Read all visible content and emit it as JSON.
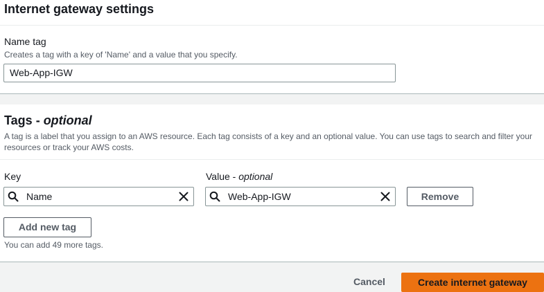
{
  "settings": {
    "title": "Internet gateway settings",
    "name_label": "Name tag",
    "name_desc": "Creates a tag with a key of 'Name' and a value that you specify.",
    "name_value": "Web-App-IGW"
  },
  "tags": {
    "title": "Tags",
    "title_suffix": "optional",
    "desc": "A tag is a label that you assign to an AWS resource. Each tag consists of a key and an optional value. You can use tags to search and filter your resources or track your AWS costs.",
    "key_label": "Key",
    "value_label": "Value",
    "value_label_suffix": "optional",
    "rows": [
      {
        "key": "Name",
        "value": "Web-App-IGW",
        "remove_label": "Remove"
      }
    ],
    "add_label": "Add new tag",
    "hint": "You can add 49 more tags."
  },
  "footer": {
    "cancel_label": "Cancel",
    "submit_label": "Create internet gateway"
  },
  "colors": {
    "primary": "#ec7211",
    "border": "#879596",
    "text": "#16191f",
    "muted": "#545b64"
  }
}
